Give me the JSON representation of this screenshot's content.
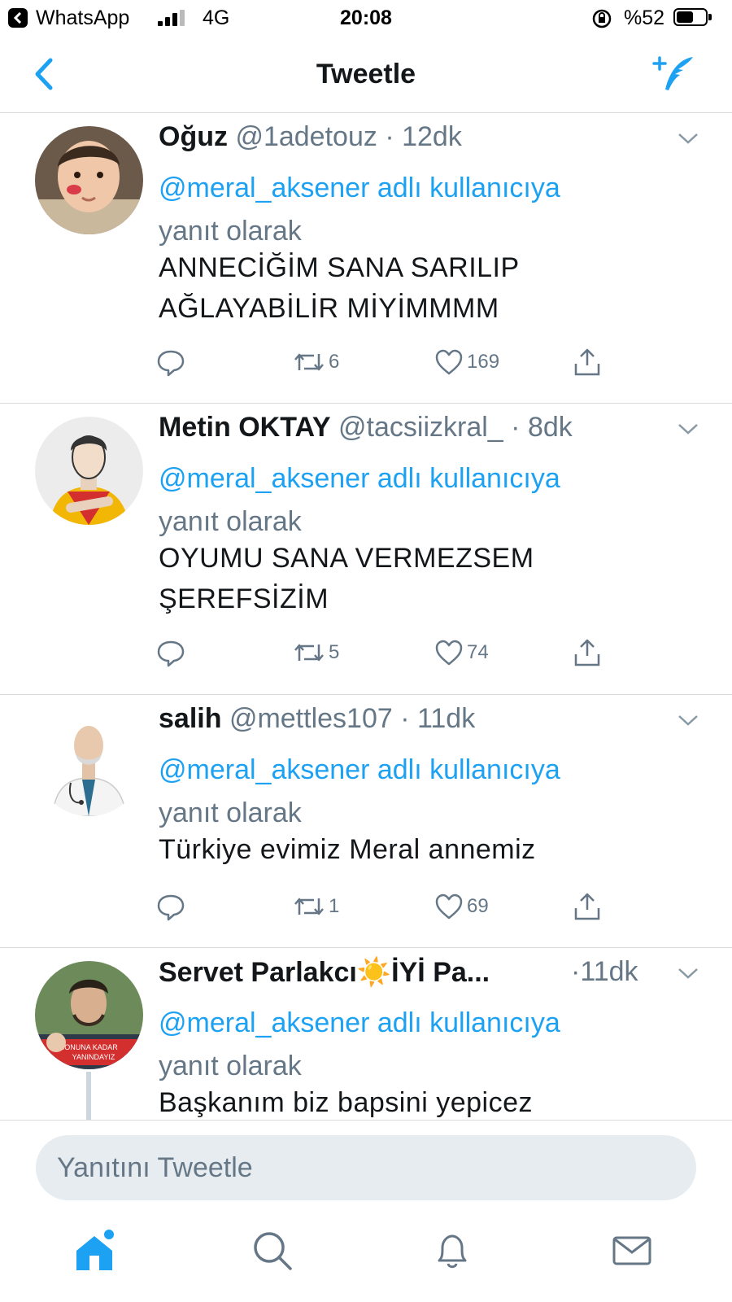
{
  "status_bar": {
    "back_app": "WhatsApp",
    "network": "4G",
    "time": "20:08",
    "battery": "%52",
    "battery_level": 0.52
  },
  "nav": {
    "title": "Tweetle",
    "back_icon": "chevron-left-icon",
    "compose_icon": "compose-tweet-icon"
  },
  "colors": {
    "accent": "#1da1f2",
    "secondary_text": "#657786",
    "primary_text": "#14171a",
    "divider": "#d6dadd"
  },
  "tweets": [
    {
      "name": "Oğuz",
      "handle": "@1adetouz",
      "dot": "·",
      "time": "12dk",
      "mention": "@meral_aksener",
      "reply_suffix": "adlı kullanıcıya",
      "reply_to": "yanıt olarak",
      "body": "ANNECİĞİM SANA SARILIP AĞLAYABİLİR MİYİMMMM",
      "retweets": "6",
      "likes": "169"
    },
    {
      "name": "Metin OKTAY",
      "handle": "@tacsiizkral_",
      "dot": "·",
      "time": "8dk",
      "mention": "@meral_aksener",
      "reply_suffix": "adlı kullanıcıya",
      "reply_to": "yanıt olarak",
      "body": "OYUMU SANA VERMEZSEM ŞEREFSİZİM",
      "retweets": "5",
      "likes": "74"
    },
    {
      "name": "salih",
      "handle": "@mettles107",
      "dot": "·",
      "time": "11dk",
      "mention": "@meral_aksener",
      "reply_suffix": "adlı kullanıcıya",
      "reply_to": "yanıt olarak",
      "body": "Türkiye evimiz Meral annemiz",
      "retweets": "1",
      "likes": "69"
    },
    {
      "name": "Servet Parlakcı☀️İYİ Pa...",
      "dot": "·",
      "time": "11dk",
      "mention": "@meral_aksener",
      "reply_suffix": "adlı kullanıcıya",
      "reply_to": "yanıt olarak",
      "body": "Başkanım biz bapsini yepicez",
      "avatar_text": "SONUNA KADAR YANINDAYIZ"
    }
  ],
  "reply_bar": {
    "placeholder": "Yanıtını Tweetle"
  },
  "tab_bar": {
    "icons": [
      "home-icon",
      "search-icon",
      "notifications-icon",
      "messages-icon"
    ]
  }
}
